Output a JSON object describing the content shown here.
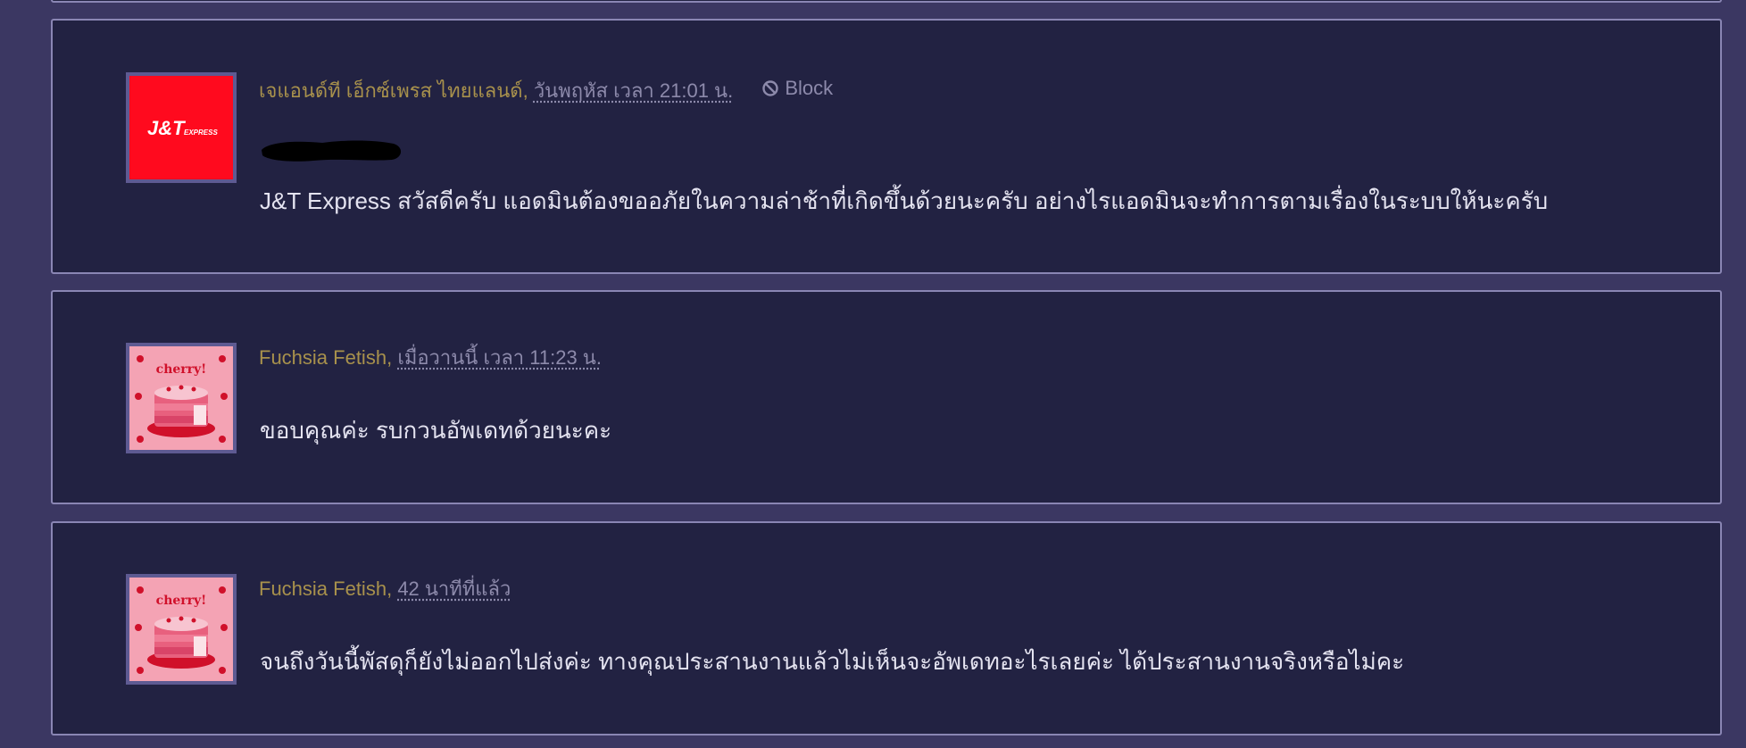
{
  "comments": [
    {
      "author": "เจแอนด์ที เอ็กซ์เพรส ไทยแลนด์",
      "separator": ",",
      "timestamp": "วันพฤหัส เวลา 21:01 น.",
      "block_label": "Block",
      "message": "J&T Express สวัสดีครับ แอดมินต้องขออภัยในความล่าช้าที่เกิดขึ้นด้วยนะครับ อย่างไรแอดมินจะทำการตามเรื่องในระบบให้นะครับ",
      "avatar": {
        "type": "logo",
        "text_main": "J&T",
        "text_sub": "EXPRESS",
        "bg_color": "#ff0a1e"
      }
    },
    {
      "author": "Fuchsia Fetish",
      "separator": ",",
      "timestamp": "เมื่อวานนี้ เวลา 11:23 น.",
      "message": "ขอบคุณค่ะ รบกวนอัพเดทด้วยนะคะ",
      "avatar": {
        "type": "cake",
        "text": "cherry!",
        "bg_color": "#f4a3b4"
      }
    },
    {
      "author": "Fuchsia Fetish",
      "separator": ",",
      "timestamp": "42 นาทีที่แล้ว",
      "message": "จนถึงวันนี้พัสดุก็ยังไม่ออกไปส่งค่ะ ทางคุณประสานงานแล้วไม่เห็นจะอัพเดทอะไรเลยค่ะ ได้ประสานงานจริงหรือไม่คะ",
      "avatar": {
        "type": "cake",
        "text": "cherry!",
        "bg_color": "#f4a3b4"
      }
    }
  ],
  "icons": {
    "block": "block-icon"
  },
  "colors": {
    "page_bg": "#3b3762",
    "card_bg": "#222242",
    "author": "#a8914c",
    "timestamp": "#8d8aab",
    "message": "#e4e3f0"
  }
}
